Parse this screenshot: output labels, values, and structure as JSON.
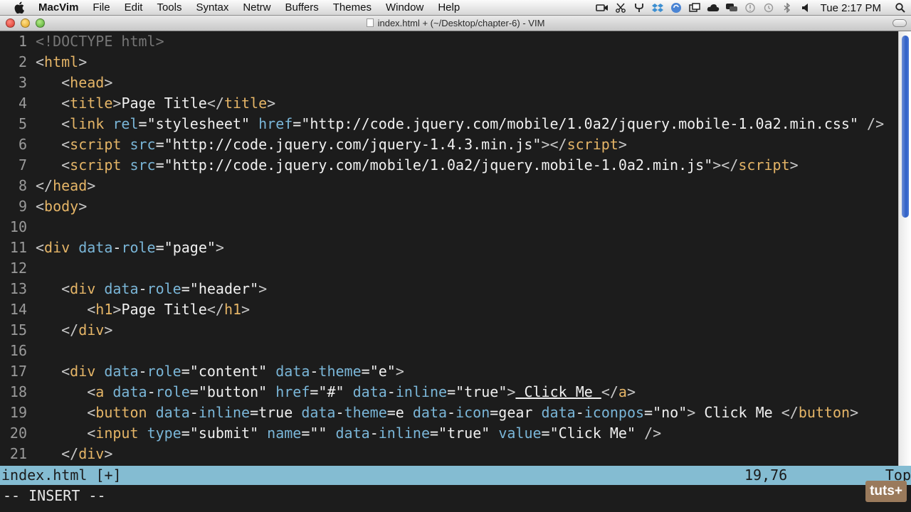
{
  "menubar": {
    "app_name": "MacVim",
    "items": [
      "File",
      "Edit",
      "Tools",
      "Syntax",
      "Netrw",
      "Buffers",
      "Themes",
      "Window",
      "Help"
    ],
    "clock": "Tue 2:17 PM"
  },
  "window": {
    "title": "index.html + (~/Desktop/chapter-6) - VIM"
  },
  "editor": {
    "colors": {
      "background": "#1c1c1c",
      "tag": "#e5b567",
      "attribute": "#7ab6d8",
      "text": "#f0f0f0",
      "line_number": "#9a9a9a"
    },
    "lines": [
      {
        "n": "1",
        "indent": "",
        "tokens": [
          [
            "doctype",
            "<!DOCTYPE html>"
          ]
        ]
      },
      {
        "n": "2",
        "indent": "",
        "tokens": [
          [
            "br",
            "<"
          ],
          [
            "tag",
            "html"
          ],
          [
            "br",
            ">"
          ]
        ]
      },
      {
        "n": "3",
        "indent": "   ",
        "tokens": [
          [
            "br",
            "<"
          ],
          [
            "tag",
            "head"
          ],
          [
            "br",
            ">"
          ]
        ]
      },
      {
        "n": "4",
        "indent": "   ",
        "tokens": [
          [
            "br",
            "<"
          ],
          [
            "tag",
            "title"
          ],
          [
            "br",
            ">"
          ],
          [
            "txt",
            "Page Title"
          ],
          [
            "br",
            "</"
          ],
          [
            "tag",
            "title"
          ],
          [
            "br",
            ">"
          ]
        ]
      },
      {
        "n": "5",
        "indent": "   ",
        "tokens": [
          [
            "br",
            "<"
          ],
          [
            "tag",
            "link"
          ],
          [
            "txt",
            " "
          ],
          [
            "attr",
            "rel"
          ],
          [
            "txt",
            "="
          ],
          [
            "str",
            "\"stylesheet\""
          ],
          [
            "txt",
            " "
          ],
          [
            "attr",
            "href"
          ],
          [
            "txt",
            "="
          ],
          [
            "str",
            "\"http://code.jquery.com/mobile/1.0a2/jquery.mobile-1.0a2.min.css\""
          ],
          [
            "txt",
            " "
          ],
          [
            "br",
            "/>"
          ]
        ]
      },
      {
        "n": "6",
        "indent": "   ",
        "tokens": [
          [
            "br",
            "<"
          ],
          [
            "tag",
            "script"
          ],
          [
            "txt",
            " "
          ],
          [
            "attr",
            "src"
          ],
          [
            "txt",
            "="
          ],
          [
            "str",
            "\"http://code.jquery.com/jquery-1.4.3.min.js\""
          ],
          [
            "br",
            "></"
          ],
          [
            "tag",
            "script"
          ],
          [
            "br",
            ">"
          ]
        ]
      },
      {
        "n": "7",
        "indent": "   ",
        "tokens": [
          [
            "br",
            "<"
          ],
          [
            "tag",
            "script"
          ],
          [
            "txt",
            " "
          ],
          [
            "attr",
            "src"
          ],
          [
            "txt",
            "="
          ],
          [
            "str",
            "\"http://code.jquery.com/mobile/1.0a2/jquery.mobile-1.0a2.min.js\""
          ],
          [
            "br",
            "></"
          ],
          [
            "tag",
            "script"
          ],
          [
            "br",
            ">"
          ]
        ]
      },
      {
        "n": "8",
        "indent": "",
        "tokens": [
          [
            "br",
            "</"
          ],
          [
            "tag",
            "head"
          ],
          [
            "br",
            ">"
          ]
        ]
      },
      {
        "n": "9",
        "indent": "",
        "tokens": [
          [
            "br",
            "<"
          ],
          [
            "tag",
            "body"
          ],
          [
            "br",
            ">"
          ]
        ]
      },
      {
        "n": "10",
        "indent": "",
        "tokens": []
      },
      {
        "n": "11",
        "indent": "",
        "tokens": [
          [
            "br",
            "<"
          ],
          [
            "tag",
            "div"
          ],
          [
            "txt",
            " "
          ],
          [
            "attr",
            "data"
          ],
          [
            "txt",
            "-"
          ],
          [
            "attr",
            "role"
          ],
          [
            "txt",
            "="
          ],
          [
            "str",
            "\"page\""
          ],
          [
            "br",
            ">"
          ]
        ]
      },
      {
        "n": "12",
        "indent": "",
        "tokens": []
      },
      {
        "n": "13",
        "indent": "   ",
        "tokens": [
          [
            "br",
            "<"
          ],
          [
            "tag",
            "div"
          ],
          [
            "txt",
            " "
          ],
          [
            "attr",
            "data"
          ],
          [
            "txt",
            "-"
          ],
          [
            "attr",
            "role"
          ],
          [
            "txt",
            "="
          ],
          [
            "str",
            "\"header\""
          ],
          [
            "br",
            ">"
          ]
        ]
      },
      {
        "n": "14",
        "indent": "      ",
        "tokens": [
          [
            "br",
            "<"
          ],
          [
            "tag",
            "h1"
          ],
          [
            "br",
            ">"
          ],
          [
            "txt",
            "Page Title"
          ],
          [
            "br",
            "</"
          ],
          [
            "tag",
            "h1"
          ],
          [
            "br",
            ">"
          ]
        ]
      },
      {
        "n": "15",
        "indent": "   ",
        "tokens": [
          [
            "br",
            "</"
          ],
          [
            "tag",
            "div"
          ],
          [
            "br",
            ">"
          ]
        ]
      },
      {
        "n": "16",
        "indent": "",
        "tokens": []
      },
      {
        "n": "17",
        "indent": "   ",
        "tokens": [
          [
            "br",
            "<"
          ],
          [
            "tag",
            "div"
          ],
          [
            "txt",
            " "
          ],
          [
            "attr",
            "data"
          ],
          [
            "txt",
            "-"
          ],
          [
            "attr",
            "role"
          ],
          [
            "txt",
            "="
          ],
          [
            "str",
            "\"content\""
          ],
          [
            "txt",
            " "
          ],
          [
            "attr",
            "data"
          ],
          [
            "txt",
            "-"
          ],
          [
            "attr",
            "theme"
          ],
          [
            "txt",
            "="
          ],
          [
            "str",
            "\"e\""
          ],
          [
            "br",
            ">"
          ]
        ]
      },
      {
        "n": "18",
        "indent": "      ",
        "tokens": [
          [
            "br",
            "<"
          ],
          [
            "tag",
            "a"
          ],
          [
            "txt",
            " "
          ],
          [
            "attr",
            "data"
          ],
          [
            "txt",
            "-"
          ],
          [
            "attr",
            "role"
          ],
          [
            "txt",
            "="
          ],
          [
            "str",
            "\"button\""
          ],
          [
            "txt",
            " "
          ],
          [
            "attr",
            "href"
          ],
          [
            "txt",
            "="
          ],
          [
            "str",
            "\"#\""
          ],
          [
            "txt",
            " "
          ],
          [
            "attr",
            "data"
          ],
          [
            "txt",
            "-"
          ],
          [
            "attr",
            "inline"
          ],
          [
            "txt",
            "="
          ],
          [
            "str",
            "\"true\""
          ],
          [
            "br",
            ">"
          ],
          [
            "ul",
            " Click Me "
          ],
          [
            "br",
            "</"
          ],
          [
            "tag",
            "a"
          ],
          [
            "br",
            ">"
          ]
        ]
      },
      {
        "n": "19",
        "indent": "      ",
        "tokens": [
          [
            "br",
            "<"
          ],
          [
            "tag",
            "button"
          ],
          [
            "txt",
            " "
          ],
          [
            "attr",
            "data"
          ],
          [
            "txt",
            "-"
          ],
          [
            "attr",
            "inline"
          ],
          [
            "txt",
            "=true "
          ],
          [
            "attr",
            "data"
          ],
          [
            "txt",
            "-"
          ],
          [
            "attr",
            "theme"
          ],
          [
            "txt",
            "=e "
          ],
          [
            "attr",
            "data"
          ],
          [
            "txt",
            "-"
          ],
          [
            "attr",
            "icon"
          ],
          [
            "txt",
            "=gear "
          ],
          [
            "attr",
            "data"
          ],
          [
            "txt",
            "-"
          ],
          [
            "attr",
            "iconpos"
          ],
          [
            "txt",
            "="
          ],
          [
            "str",
            "\"no\""
          ],
          [
            "br",
            ">"
          ],
          [
            "txt",
            " Click Me "
          ],
          [
            "br",
            "</"
          ],
          [
            "tag",
            "button"
          ],
          [
            "br",
            ">"
          ]
        ]
      },
      {
        "n": "20",
        "indent": "      ",
        "tokens": [
          [
            "br",
            "<"
          ],
          [
            "tag",
            "input"
          ],
          [
            "txt",
            " "
          ],
          [
            "attr",
            "type"
          ],
          [
            "txt",
            "="
          ],
          [
            "str",
            "\"submit\""
          ],
          [
            "txt",
            " "
          ],
          [
            "attr",
            "name"
          ],
          [
            "txt",
            "="
          ],
          [
            "str",
            "\"\""
          ],
          [
            "txt",
            " "
          ],
          [
            "attr",
            "data"
          ],
          [
            "txt",
            "-"
          ],
          [
            "attr",
            "inline"
          ],
          [
            "txt",
            "="
          ],
          [
            "str",
            "\"true\""
          ],
          [
            "txt",
            " "
          ],
          [
            "attr",
            "value"
          ],
          [
            "txt",
            "="
          ],
          [
            "str",
            "\"Click Me\""
          ],
          [
            "txt",
            " "
          ],
          [
            "br",
            "/>"
          ]
        ]
      },
      {
        "n": "21",
        "indent": "   ",
        "tokens": [
          [
            "br",
            "</"
          ],
          [
            "tag",
            "div"
          ],
          [
            "br",
            ">"
          ]
        ]
      }
    ]
  },
  "statusline": {
    "filename": "index.html [+]",
    "position": "19,76",
    "scroll": "Top",
    "color": "#84bcd2"
  },
  "mode": "-- INSERT --",
  "watermark": "tuts+"
}
